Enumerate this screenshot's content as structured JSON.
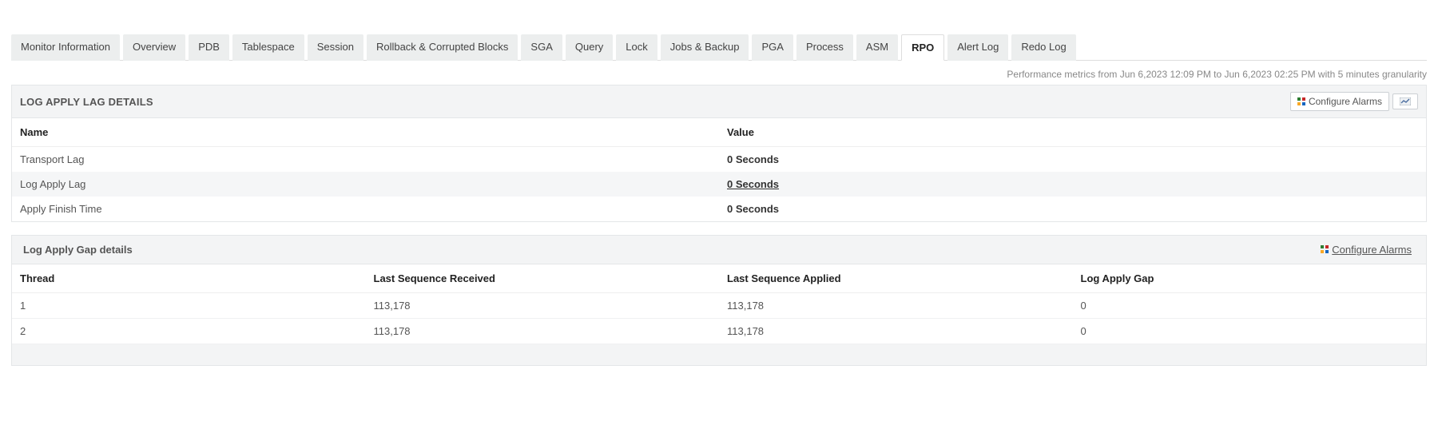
{
  "tabs": {
    "items": [
      {
        "label": "Monitor Information"
      },
      {
        "label": "Overview"
      },
      {
        "label": "PDB"
      },
      {
        "label": "Tablespace"
      },
      {
        "label": "Session"
      },
      {
        "label": "Rollback & Corrupted Blocks"
      },
      {
        "label": "SGA"
      },
      {
        "label": "Query"
      },
      {
        "label": "Lock"
      },
      {
        "label": "Jobs & Backup"
      },
      {
        "label": "PGA"
      },
      {
        "label": "Process"
      },
      {
        "label": "ASM"
      },
      {
        "label": "RPO"
      },
      {
        "label": "Alert Log"
      },
      {
        "label": "Redo Log"
      }
    ],
    "active_index": 13
  },
  "metrics_note": "Performance metrics from Jun 6,2023 12:09 PM to Jun 6,2023 02:25 PM with 5 minutes granularity",
  "lag_panel": {
    "title": "LOG APPLY LAG DETAILS",
    "configure_label": "Configure Alarms",
    "columns": {
      "name": "Name",
      "value": "Value"
    },
    "rows": [
      {
        "name": "Transport Lag",
        "value": "0 Seconds",
        "emph": "bold"
      },
      {
        "name": "Log Apply Lag",
        "value": "0 Seconds",
        "emph": "bold-under"
      },
      {
        "name": "Apply Finish Time",
        "value": "0 Seconds",
        "emph": "bold"
      }
    ]
  },
  "gap_panel": {
    "title": "Log Apply Gap details",
    "configure_label": "Configure Alarms",
    "columns": {
      "thread": "Thread",
      "recv": "Last Sequence Received",
      "apl": "Last Sequence Applied",
      "gap": "Log Apply Gap"
    },
    "rows": [
      {
        "thread": "1",
        "recv": "113,178",
        "apl": "113,178",
        "gap": "0"
      },
      {
        "thread": "2",
        "recv": "113,178",
        "apl": "113,178",
        "gap": "0"
      }
    ]
  }
}
